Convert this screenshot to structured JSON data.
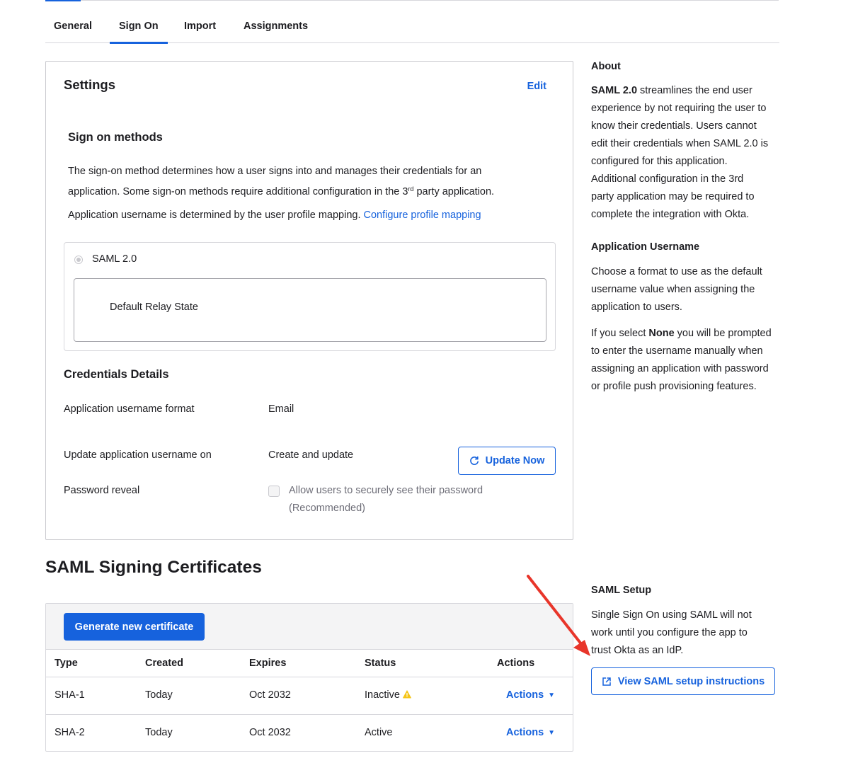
{
  "tabs": [
    {
      "label": "General"
    },
    {
      "label": "Sign On",
      "active": true
    },
    {
      "label": "Import"
    },
    {
      "label": "Assignments"
    }
  ],
  "settings": {
    "title": "Settings",
    "edit_label": "Edit",
    "sign_on_methods_title": "Sign on methods",
    "desc_line1": "The sign-on method determines how a user signs into and manages their credentials for an",
    "desc_line2_pre": "application. Some sign-on methods require additional configuration in the 3",
    "desc_line2_sup": "rd",
    "desc_line2_post": " party application.",
    "username_note": "Application username is determined by the user profile mapping. ",
    "configure_link": "Configure profile mapping",
    "method_label": "SAML 2.0",
    "relay_state_label": "Default Relay State"
  },
  "credentials": {
    "title": "Credentials Details",
    "username_format_label": "Application username format",
    "username_format_value": "Email",
    "update_on_label": "Update application username on",
    "update_on_value": "Create and update",
    "update_now_label": "Update Now",
    "password_reveal_label": "Password reveal",
    "password_reveal_option_line1": "Allow users to securely see their password",
    "password_reveal_option_line2": "(Recommended)"
  },
  "certificates": {
    "title": "SAML Signing Certificates",
    "generate_label": "Generate new certificate",
    "columns": [
      "Type",
      "Created",
      "Expires",
      "Status",
      "Actions"
    ],
    "rows": [
      {
        "type": "SHA-1",
        "created": "Today",
        "expires": "Oct 2032",
        "status": "Inactive",
        "actions": "Actions"
      },
      {
        "type": "SHA-2",
        "created": "Today",
        "expires": "Oct 2032",
        "status": "Active",
        "actions": "Actions"
      }
    ]
  },
  "about": {
    "title": "About",
    "saml_bold": "SAML 2.0",
    "line1": " streamlines the end user",
    "line2": "experience by not requiring the user to",
    "line3": "know their credentials. Users cannot",
    "line4": "edit their credentials when SAML 2.0 is",
    "line5": "configured for this application.",
    "line6": "Additional configuration in the 3rd",
    "line7": "party application may be required to",
    "line8": "complete the integration with Okta."
  },
  "app_username": {
    "title": "Application Username",
    "line1": "Choose a format to use as the default",
    "line2": "username value when assigning the",
    "line3": "application to users.",
    "p2_pre": "If you select ",
    "p2_bold": "None",
    "p2_post": " you will be prompted",
    "p2_line2": "to enter the username manually when",
    "p2_line3": "assigning an application with password",
    "p2_line4": "or profile push provisioning features."
  },
  "saml_setup": {
    "title": "SAML Setup",
    "line1": "Single Sign On using SAML will not",
    "line2": "work until you configure the app to",
    "line3": "trust Okta as an IdP.",
    "button_label": "View SAML setup instructions"
  },
  "colors": {
    "accent": "#1662dd",
    "annotation_arrow": "#e8352a",
    "warning": "#f5c518"
  }
}
